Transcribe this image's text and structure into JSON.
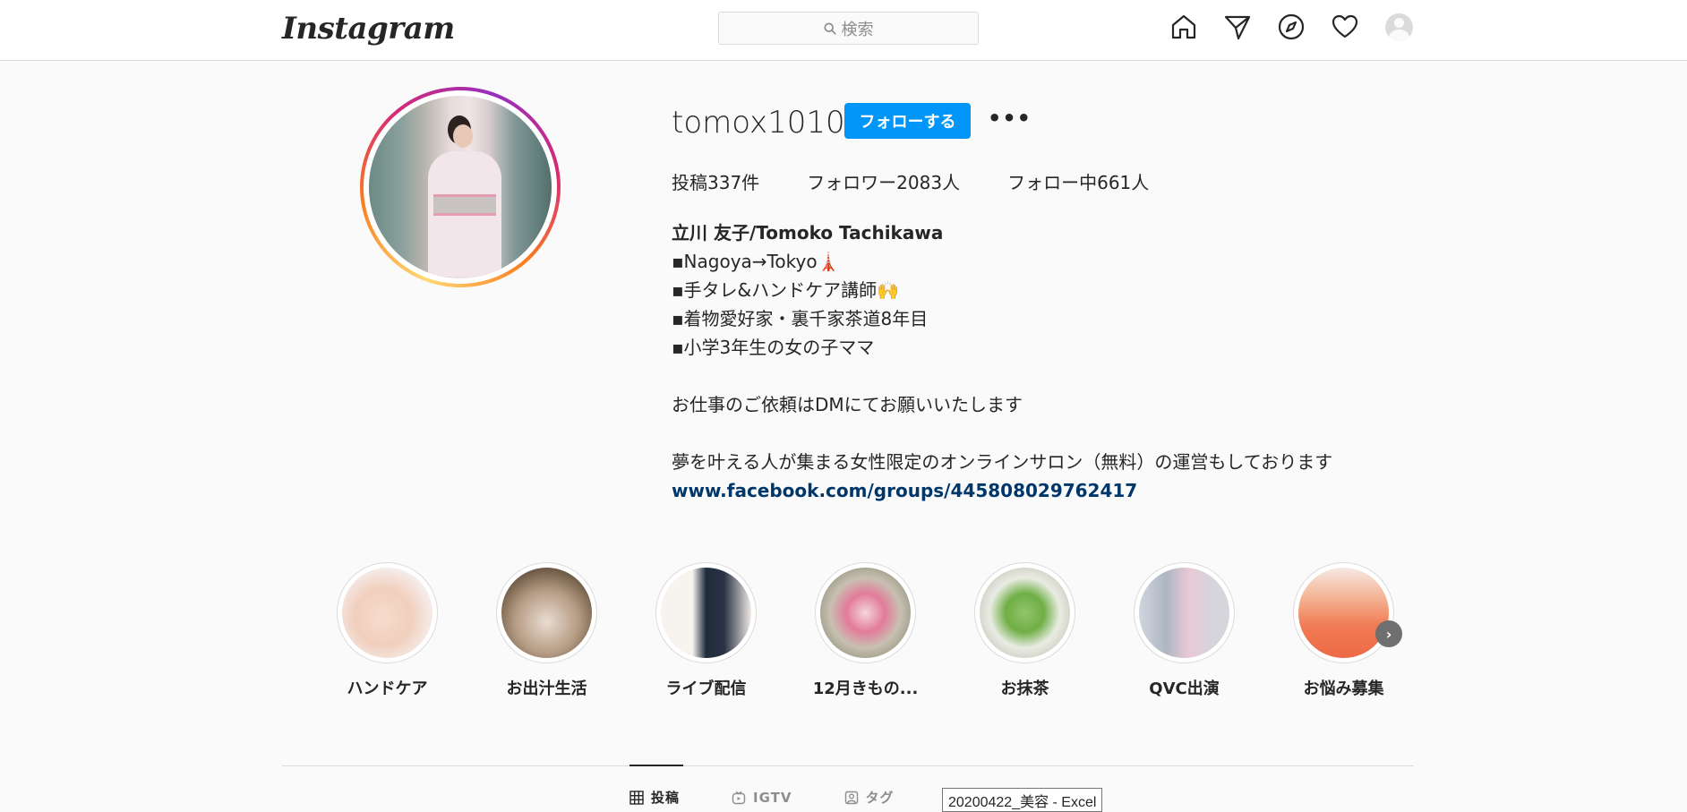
{
  "header": {
    "logo": "Instagram",
    "search_placeholder": "検索",
    "icons": [
      "home-icon",
      "direct-icon",
      "explore-icon",
      "activity-heart-icon",
      "profile-avatar"
    ]
  },
  "profile": {
    "username": "tomox1010",
    "follow_label": "フォローする",
    "more_label": "•••",
    "stats": {
      "posts": "投稿337件",
      "followers": "フォロワー2083人",
      "following": "フォロー中661人"
    },
    "bio": {
      "name": "立川 友子/Tomoko Tachikawa",
      "line1": "▪︎Nagoya→Tokyo🗼",
      "line2": "▪︎手タレ&ハンドケア講師🙌",
      "line3": "▪︎着物愛好家・裏千家茶道8年目",
      "line4": "▪︎小学3年生の女の子ママ",
      "line5": "お仕事のご依頼はDMにてお願いいたします",
      "line6": "夢を叶える人が集まる女性限定のオンラインサロン（無料）の運営もしております",
      "link": "www.facebook.com/groups/445808029762417"
    }
  },
  "highlights": [
    {
      "label": "ハンドケア"
    },
    {
      "label": "お出汁生活"
    },
    {
      "label": "ライブ配信"
    },
    {
      "label": "12月きもの..."
    },
    {
      "label": "お抹茶"
    },
    {
      "label": "QVC出演"
    },
    {
      "label": "お悩み募集"
    }
  ],
  "tabs": {
    "posts": "投稿",
    "igtv": "IGTV",
    "tagged": "タグ"
  },
  "tooltip": "20200422_美容 - Excel",
  "colors": {
    "accent": "#0095f6",
    "link": "#00376b",
    "background": "#fafafa"
  }
}
